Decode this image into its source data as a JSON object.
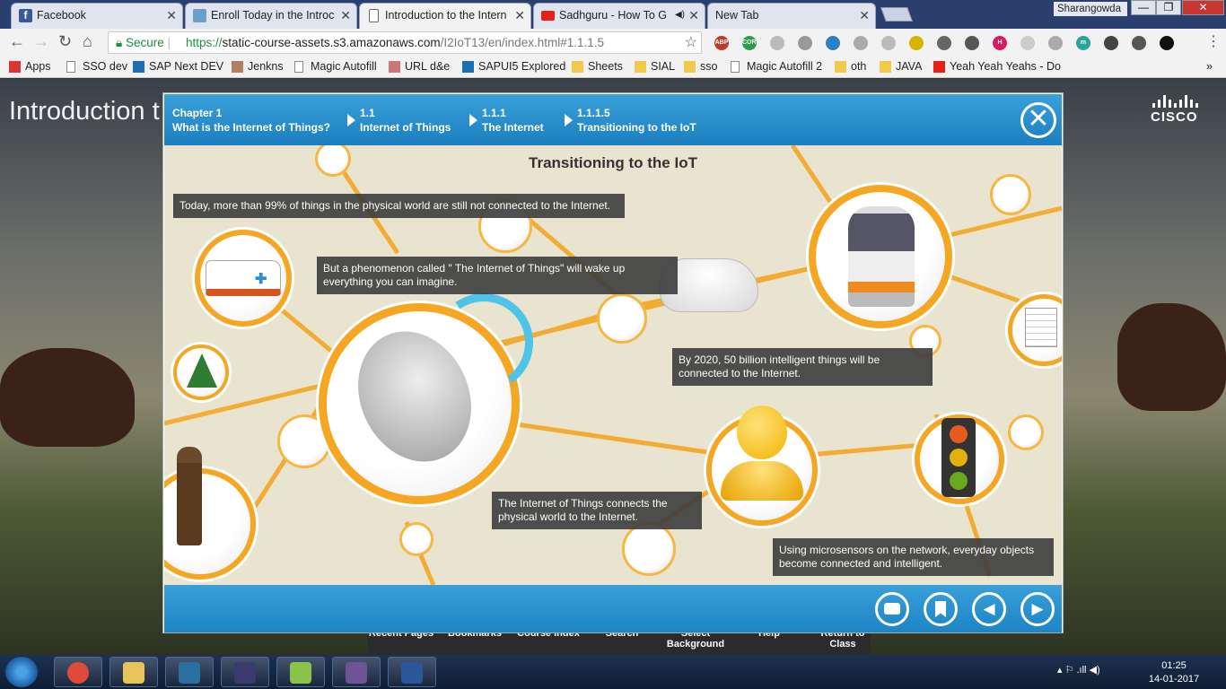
{
  "browser": {
    "tabs": [
      {
        "label": "Facebook",
        "favicon_color": "#3b5998"
      },
      {
        "label": "Enroll Today in the Introc",
        "favicon_color": "#6aa0c8"
      },
      {
        "label": "Introduction to the Intern",
        "favicon_color": "#ffffff",
        "active": true
      },
      {
        "label": "Sadhguru - How To G",
        "favicon_color": "#e62117",
        "audio": "◀)"
      },
      {
        "label": "New Tab",
        "favicon_color": ""
      }
    ],
    "user_name": "Sharangowda",
    "window_buttons": {
      "minimize": "—",
      "maximize": "❐",
      "close": "✕"
    },
    "secure_label": "Secure",
    "url_scheme": "https://",
    "url_host": "static-course-assets.s3.amazonaws.com",
    "url_path": "/I2IoT13/en/index.html#1.1.1.5",
    "bookmarks": [
      {
        "label": "Apps",
        "icon": "apps-grid-icon",
        "color": "#d33"
      },
      {
        "label": "SSO dev",
        "icon": "page-icon",
        "color": "#888"
      },
      {
        "label": "SAP Next DEV",
        "icon": "sap-icon",
        "color": "#1a6fb5"
      },
      {
        "label": "Jenkns",
        "icon": "jenkins-icon",
        "color": "#b08060"
      },
      {
        "label": "Magic Autofill",
        "icon": "page-icon",
        "color": "#888"
      },
      {
        "label": "URL d&e",
        "icon": "url-icon",
        "color": "#c77"
      },
      {
        "label": "SAPUI5 Explored",
        "icon": "ui5-icon",
        "color": "#1a6fb5"
      },
      {
        "label": "Sheets",
        "icon": "folder-icon",
        "color": "#f2c94c"
      },
      {
        "label": "SIAL",
        "icon": "folder-icon",
        "color": "#f2c94c"
      },
      {
        "label": "sso",
        "icon": "folder-icon",
        "color": "#f2c94c"
      },
      {
        "label": "Magic Autofill 2",
        "icon": "page-icon",
        "color": "#888"
      },
      {
        "label": "oth",
        "icon": "folder-icon",
        "color": "#f2c94c"
      },
      {
        "label": "JAVA",
        "icon": "folder-icon",
        "color": "#f2c94c"
      },
      {
        "label": "Yeah Yeah Yeahs - Do",
        "icon": "youtube-icon",
        "color": "#e62117"
      }
    ],
    "bookmarks_overflow": "»",
    "extensions": [
      {
        "name": "adblock-plus-icon",
        "label": "ABP",
        "color": "#c0392b"
      },
      {
        "name": "cors-icon",
        "label": "CORS",
        "color": "#2e9b4b"
      },
      {
        "name": "extension-icon-3",
        "label": "",
        "color": "#bbb"
      },
      {
        "name": "extension-icon-4",
        "label": "",
        "color": "#999"
      },
      {
        "name": "extension-icon-5",
        "label": "",
        "color": "#2d7fc0"
      },
      {
        "name": "extension-icon-6",
        "label": "",
        "color": "#aaa"
      },
      {
        "name": "extension-icon-7",
        "label": "",
        "color": "#bbb"
      },
      {
        "name": "extension-icon-8",
        "label": "",
        "color": "#d4b500"
      },
      {
        "name": "extension-icon-9",
        "label": "",
        "color": "#666"
      },
      {
        "name": "extension-icon-10",
        "label": "",
        "color": "#555"
      },
      {
        "name": "extension-icon-11",
        "label": "H",
        "color": "#d81b60"
      },
      {
        "name": "extension-icon-12",
        "label": "",
        "color": "#ccc"
      },
      {
        "name": "extension-icon-13",
        "label": "",
        "color": "#aaa"
      },
      {
        "name": "extension-icon-14",
        "label": "m",
        "color": "#26a69a"
      },
      {
        "name": "pocket-icon",
        "label": "",
        "color": "#444"
      },
      {
        "name": "extension-icon-16",
        "label": "",
        "color": "#555"
      },
      {
        "name": "eye-icon",
        "label": "",
        "color": "#111"
      }
    ]
  },
  "page": {
    "title": "Introduction t",
    "brand": "CISCO",
    "bottom_nav": [
      {
        "label": "Recent Pages"
      },
      {
        "label": "Bookmarks"
      },
      {
        "label": "Course Index"
      },
      {
        "label": "Search"
      },
      {
        "label": "Select Background"
      },
      {
        "label": "Help"
      },
      {
        "label": "Return to Class"
      }
    ]
  },
  "modal": {
    "breadcrumb": [
      {
        "number": "Chapter 1",
        "title": "What is the Internet of Things?"
      },
      {
        "number": "1.1",
        "title": "Internet of Things"
      },
      {
        "number": "1.1.1",
        "title": "The Internet"
      },
      {
        "number": "1.1.1.5",
        "title": "Transitioning to the IoT"
      }
    ],
    "close_symbol": "✕",
    "heading": "Transitioning to the IoT",
    "captions": [
      "Today, more than 99% of things in the physical world are still not connected to the Internet.",
      "But a phenomenon called \" The Internet of Things\"  will wake up everything you can imagine.",
      "By 2020, 50 billion intelligent things will be connected to the Internet.",
      "The Internet of Things connects the physical world to the Internet.",
      "Using microsensors on the network, everyday objects become connected and intelligent."
    ],
    "footer_buttons": {
      "comment": "▮",
      "bookmark": "▮",
      "previous": "◀",
      "next": "▶"
    },
    "accent_color": "#f5a623",
    "header_color": "#2a8fd0"
  },
  "taskbar": {
    "apps": [
      {
        "name": "chrome-taskbar-icon",
        "color": "#e04a3a"
      },
      {
        "name": "file-explorer-taskbar-icon",
        "color": "#e8c35a"
      },
      {
        "name": "sourcetree-taskbar-icon",
        "color": "#2a6fa0"
      },
      {
        "name": "eclipse-taskbar-icon",
        "color": "#3b3b6b"
      },
      {
        "name": "notepadpp-taskbar-icon",
        "color": "#8bc34a"
      },
      {
        "name": "github-taskbar-icon",
        "color": "#6e5494"
      },
      {
        "name": "word-taskbar-icon",
        "color": "#2b579a"
      }
    ],
    "tray": "▴  ⚐  .ıll  ◀)",
    "time": "01:25",
    "date": "14-01-2017"
  }
}
